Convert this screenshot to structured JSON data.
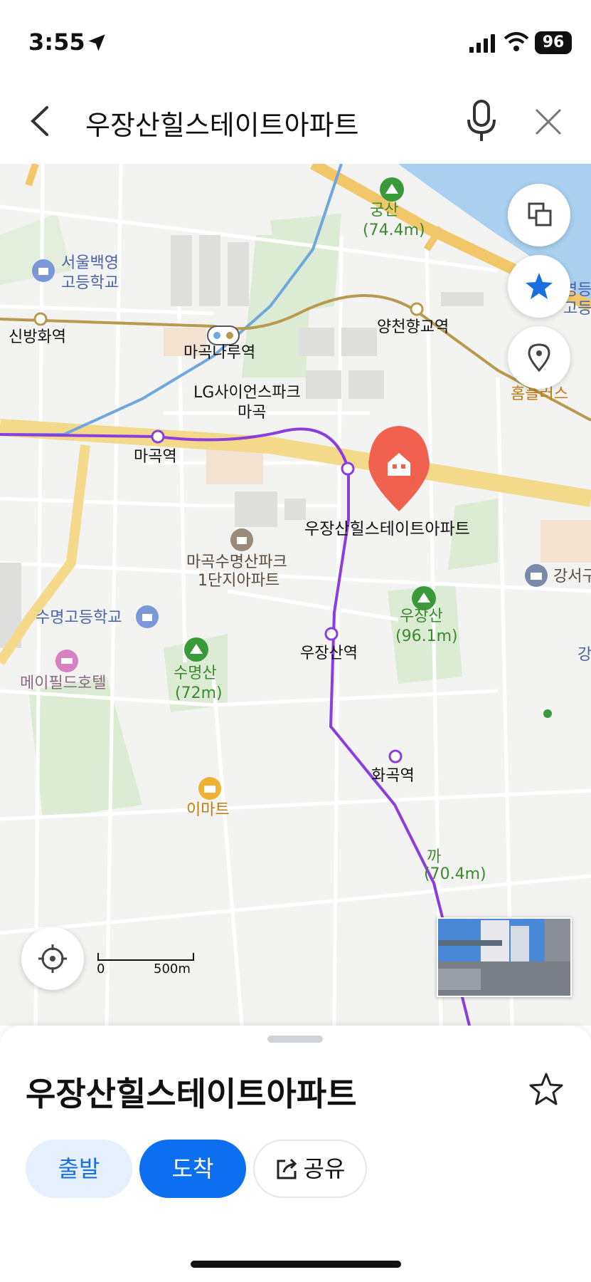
{
  "status_bar": {
    "time": "3:55",
    "battery": "96"
  },
  "search": {
    "query": "우장산힐스테이트아파트"
  },
  "map": {
    "labels": {
      "gungsan_name": "궁산",
      "gungsan_height": "(74.4m)",
      "seoul_school_1": "서울백영",
      "seoul_school_2": "고등학교",
      "yeongdeung_1": "영등",
      "yeongdeung_2": "고등",
      "sinbanghwa": "신방화역",
      "magoknaru": "마곡나루역",
      "yangcheonhyanggyo": "양천향교역",
      "homeplus": "홈플러스",
      "lg_park_1": "LG사이언스파크",
      "lg_park_2": "마곡",
      "magok": "마곡역",
      "target_place": "우장산힐스테이트아파트",
      "magok_apt_1": "마곡수명산파크",
      "magok_apt_2": "1단지아파트",
      "gangseo": "강서구",
      "sumyeong_school": "수명고등학교",
      "ujangsan_name": "우장산",
      "ujangsan_height": "(96.1m)",
      "ujangsan_station": "우장산역",
      "gang_partial": "강",
      "mayfield": "메이필드호텔",
      "sumyeongsan_name": "수명산",
      "sumyeongsan_height": "(72m)",
      "hwagok": "화곡역",
      "emart": "이마트",
      "kkachi_partial": "까",
      "kkachi_height": "(70.4m)"
    },
    "scale": {
      "zero": "0",
      "distance": "500m"
    },
    "colors": {
      "line9": "#b89a4e",
      "line5": "#8a3ee0",
      "airport": "#6fa8dc",
      "road": "#f5d98a",
      "park": "#dcebd3",
      "river": "#a9d0f0",
      "pin": "#f06150"
    }
  },
  "sheet": {
    "title": "우장산힐스테이트아파트",
    "buttons": {
      "departure": "출발",
      "arrival": "도착",
      "share": "공유"
    }
  }
}
